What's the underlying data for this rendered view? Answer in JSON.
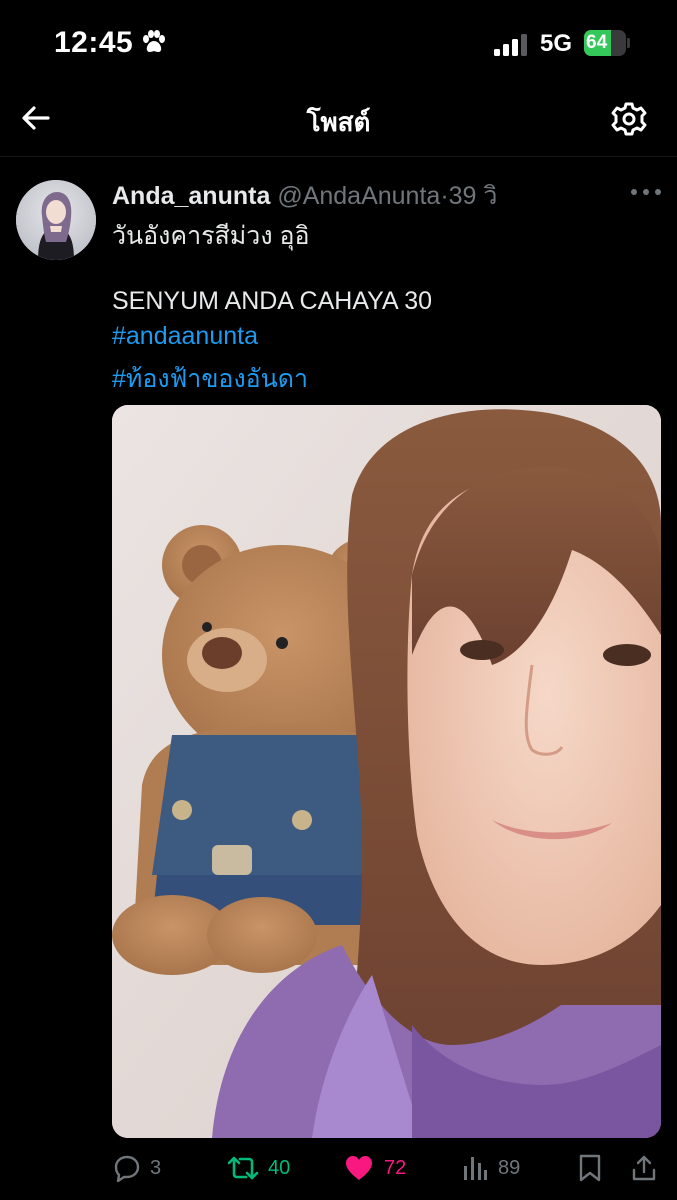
{
  "status_bar": {
    "time": "12:45",
    "network": "5G",
    "battery": "64",
    "battery_level": 0.64
  },
  "nav": {
    "title": "โพสต์",
    "back_icon": "arrow-left-icon",
    "settings_icon": "gear-icon"
  },
  "tweet": {
    "display_name": "Anda_anunta",
    "handle": "@AndaAnunta",
    "separator": "·",
    "age": "39 วิ",
    "text_line1": "วันอังคารสีม่วง อุอิ",
    "text_line2": "SENYUM ANDA CAHAYA 30",
    "hashtag1": "#andaanunta",
    "hashtag2": "#ท้องฟ้าของอันดา"
  },
  "actions": {
    "reply_count": "3",
    "retweet_count": "40",
    "like_count": "72",
    "views_count": "89"
  },
  "colors": {
    "background": "#000000",
    "text": "#e7e9ea",
    "muted": "#71767b",
    "link": "#1d9bf0",
    "retweet": "#00ba7c",
    "like": "#f91880",
    "battery": "#34c759"
  }
}
